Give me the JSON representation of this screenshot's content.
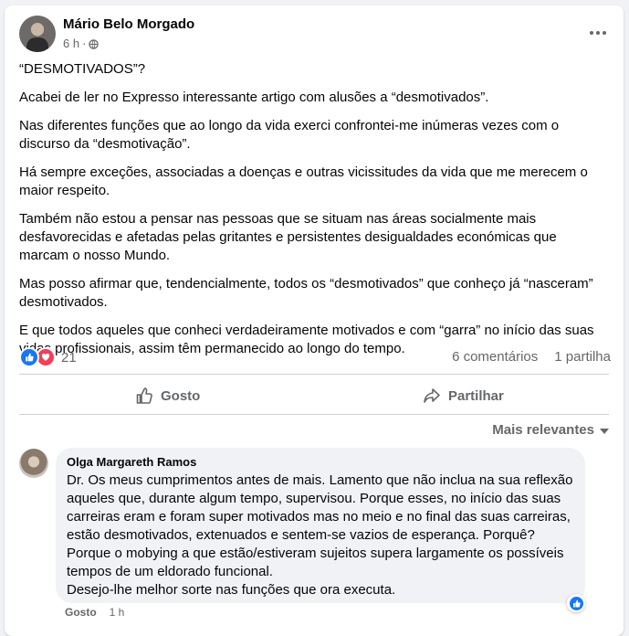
{
  "post": {
    "author": "Mário Belo Morgado",
    "time": "6 h",
    "separator": "·",
    "paragraphs": [
      "“DESMOTIVADOS”?",
      "Acabei de ler no Expresso interessante artigo com alusões a “desmotivados”.",
      "Nas diferentes funções que ao longo da vida exerci confrontei-me inúmeras vezes com o discurso da “desmotivação”.",
      "Há sempre exceções, associadas a doenças e outras vicissitudes da vida que me merecem o maior respeito.",
      "Também não estou a pensar nas pessoas que se situam nas áreas socialmente mais desfavorecidas e afetadas pelas gritantes e persistentes desigualdades económicas que marcam o nosso Mundo.",
      "Mas posso afirmar que, tendencialmente, todos os “desmotivados” que conheço já “nasceram” desmotivados.",
      "E que todos aqueles que conheci verdadeiramente motivados e com “garra” no início das suas vidas profissionais, assim têm permanecido ao longo do tempo."
    ],
    "reaction_count": "21",
    "comments_count": "6 comentários",
    "shares_count": "1 partilha"
  },
  "actions": {
    "like_label": "Gosto",
    "share_label": "Partilhar"
  },
  "comments_sort": "Mais relevantes",
  "comment": {
    "author": "Olga Margareth Ramos",
    "lines": [
      "Dr. Os meus cumprimentos antes de mais. Lamento que não inclua na sua reflexão",
      "aqueles que, durante algum tempo, supervisou. Porque esses, no início das suas",
      "carreiras eram e foram super motivados mas no meio e no final das suas carreiras,",
      "estão desmotivados, extenuados e sentem-se vazios de esperança. Porquê?",
      "Porque o mobying a que estão/estiveram sujeitos supera largamente os possíveis",
      "tempos de um eldorado funcional.",
      "Desejo-lhe melhor sorte nas funções que ora executa."
    ],
    "like_label": "Gosto",
    "time": "1 h"
  },
  "colors": {
    "like_blue": "#1877f2",
    "love_red": "#f33e58",
    "secondary_text": "#65676b"
  }
}
